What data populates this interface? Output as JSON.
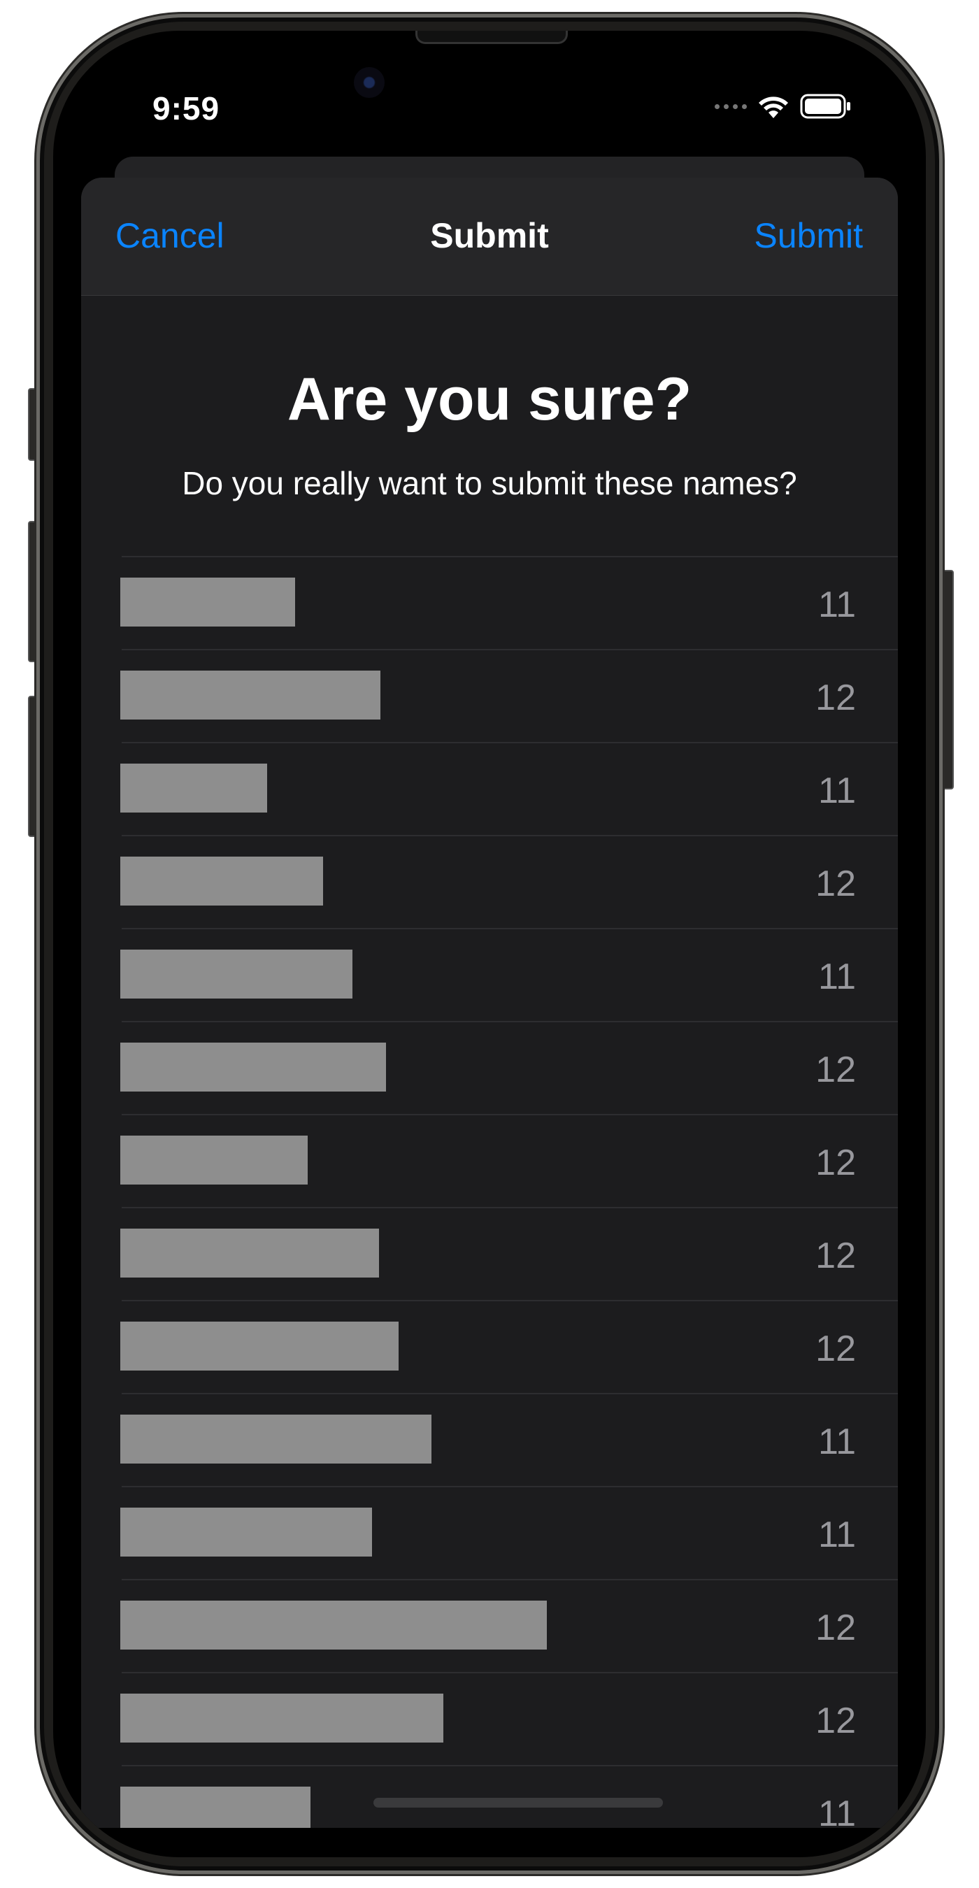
{
  "status_bar": {
    "time": "9:59",
    "icons": [
      "cellular-dots-icon",
      "wifi-icon",
      "battery-icon"
    ]
  },
  "nav": {
    "cancel_label": "Cancel",
    "title": "Submit",
    "submit_label": "Submit"
  },
  "dialog": {
    "heading": "Are you sure?",
    "message": "Do you really want to submit these names?"
  },
  "names": [
    {
      "name": "[redacted]",
      "count": "11"
    },
    {
      "name": "[redacted]",
      "count": "12"
    },
    {
      "name": "[redacted]",
      "count": "11"
    },
    {
      "name": "[redacted]",
      "count": "12"
    },
    {
      "name": "[redacted]",
      "count": "11"
    },
    {
      "name": "[redacted]",
      "count": "12"
    },
    {
      "name": "[redacted]",
      "count": "12"
    },
    {
      "name": "[redacted]",
      "count": "12"
    },
    {
      "name": "[redacted]",
      "count": "12"
    },
    {
      "name": "[redacted]",
      "count": "11"
    },
    {
      "name": "[redacted]",
      "count": "11"
    },
    {
      "name": "[redacted]",
      "count": "12"
    },
    {
      "name": "[redacted]",
      "count": "12"
    },
    {
      "name": "[redacted]",
      "count": "11"
    }
  ],
  "colors": {
    "accent": "#0a84ff",
    "sheet_background": "#1c1c1e",
    "nav_background": "#262628",
    "redaction": "#8e8e8e",
    "secondary_text": "#98989d"
  }
}
